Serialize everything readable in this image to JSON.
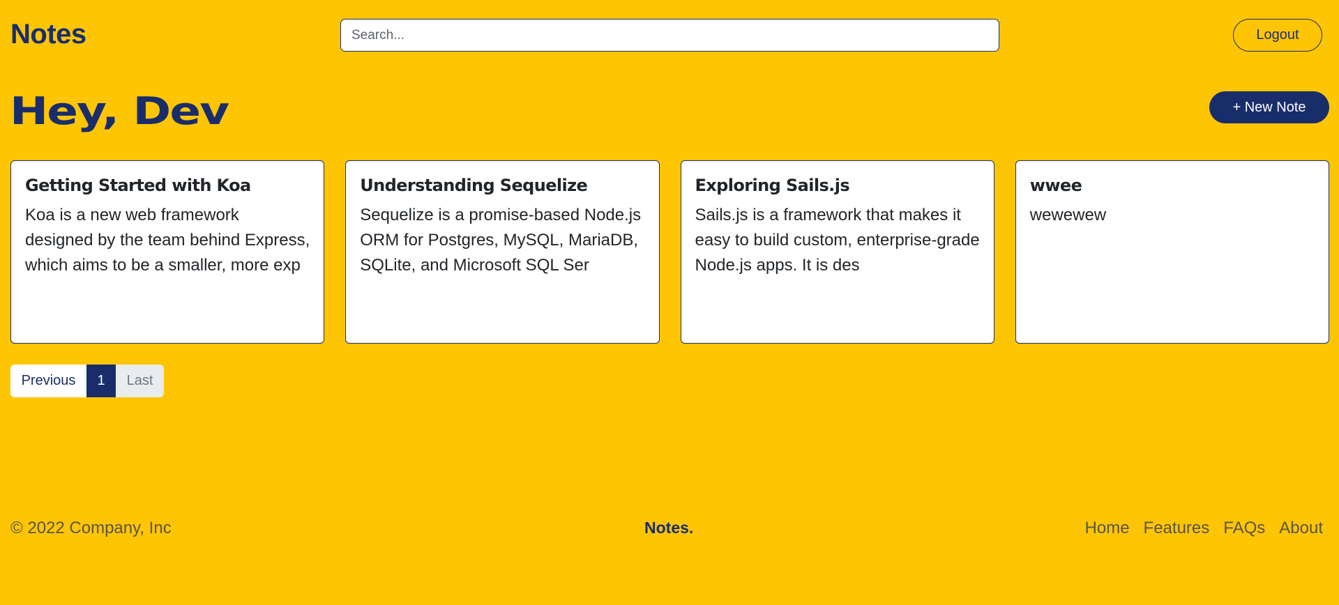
{
  "header": {
    "brand": "Notes",
    "search_placeholder": "Search...",
    "search_value": "",
    "logout_label": "Logout"
  },
  "main": {
    "greeting": "Hey, Dev",
    "new_note_label": "+ New Note",
    "notes": [
      {
        "title": "Getting Started with Koa",
        "body": "Koa is a new web framework designed by the team behind Express, which aims to be a smaller, more exp"
      },
      {
        "title": "Understanding Sequelize",
        "body": "Sequelize is a promise-based Node.js ORM for Postgres, MySQL, MariaDB, SQLite, and Microsoft SQL Ser"
      },
      {
        "title": "Exploring Sails.js",
        "body": "Sails.js is a framework that makes it easy to build custom, enterprise-grade Node.js apps. It is des"
      },
      {
        "title": "wwee",
        "body": "wewewew"
      }
    ],
    "pagination": {
      "previous_label": "Previous",
      "current_page": "1",
      "last_label": "Last"
    }
  },
  "footer": {
    "copyright": "© 2022 Company, Inc",
    "brand": "Notes.",
    "links": [
      "Home",
      "Features",
      "FAQs",
      "About"
    ]
  },
  "colors": {
    "background": "#fec505",
    "primary": "#1a2d6b",
    "card_bg": "#ffffff",
    "text": "#212529"
  }
}
